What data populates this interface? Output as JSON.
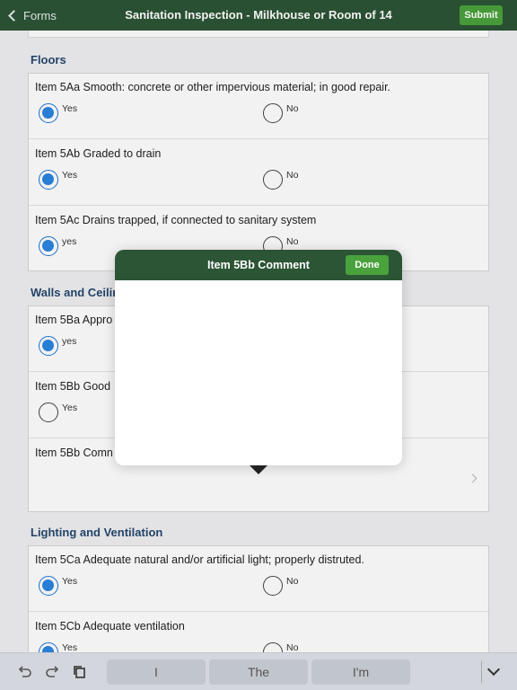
{
  "nav": {
    "back_label": "Forms",
    "title": "Sanitation Inspection - Milkhouse or Room of 14",
    "submit_label": "Submit"
  },
  "sections": [
    {
      "title": "Floors",
      "items": [
        {
          "question": "Item 5Aa Smooth: concrete or other impervious material; in good repair.",
          "yes": "Yes",
          "no": "No",
          "selected": "yes"
        },
        {
          "question": "Item 5Ab Graded to drain",
          "yes": "Yes",
          "no": "No",
          "selected": "yes"
        },
        {
          "question": "Item 5Ac Drains trapped, if connected to sanitary system",
          "yes": "yes",
          "no": "No",
          "selected": "yes"
        }
      ]
    },
    {
      "title": "Walls and Ceilir",
      "items": [
        {
          "question": "Item 5Ba Appro",
          "yes": "yes",
          "selected": "yes"
        },
        {
          "question": "Item 5Bb Good",
          "yes": "Yes",
          "selected": "none"
        },
        {
          "question": "Item 5Bb Comn"
        }
      ]
    },
    {
      "title": "Lighting and Ventilation",
      "items": [
        {
          "question": "Item 5Ca Adequate natural and/or artificial light; properly distruted.",
          "yes": "Yes",
          "no": "No",
          "selected": "yes"
        },
        {
          "question": "Item 5Cb Adequate ventilation",
          "yes": "Yes",
          "no": "No",
          "selected": "yes"
        }
      ]
    }
  ],
  "popover": {
    "title": "Item 5Bb Comment",
    "done_label": "Done",
    "text": ""
  },
  "keyboard": {
    "suggestions": [
      "I",
      "The",
      "I'm"
    ],
    "icons": [
      "undo-icon",
      "redo-icon",
      "paste-icon",
      "keyboard-dismiss-icon"
    ]
  },
  "colors": {
    "nav_green": "#2c5535",
    "button_green": "#4aa23c",
    "radio_blue": "#2b84e0",
    "section_blue": "#26486e"
  }
}
